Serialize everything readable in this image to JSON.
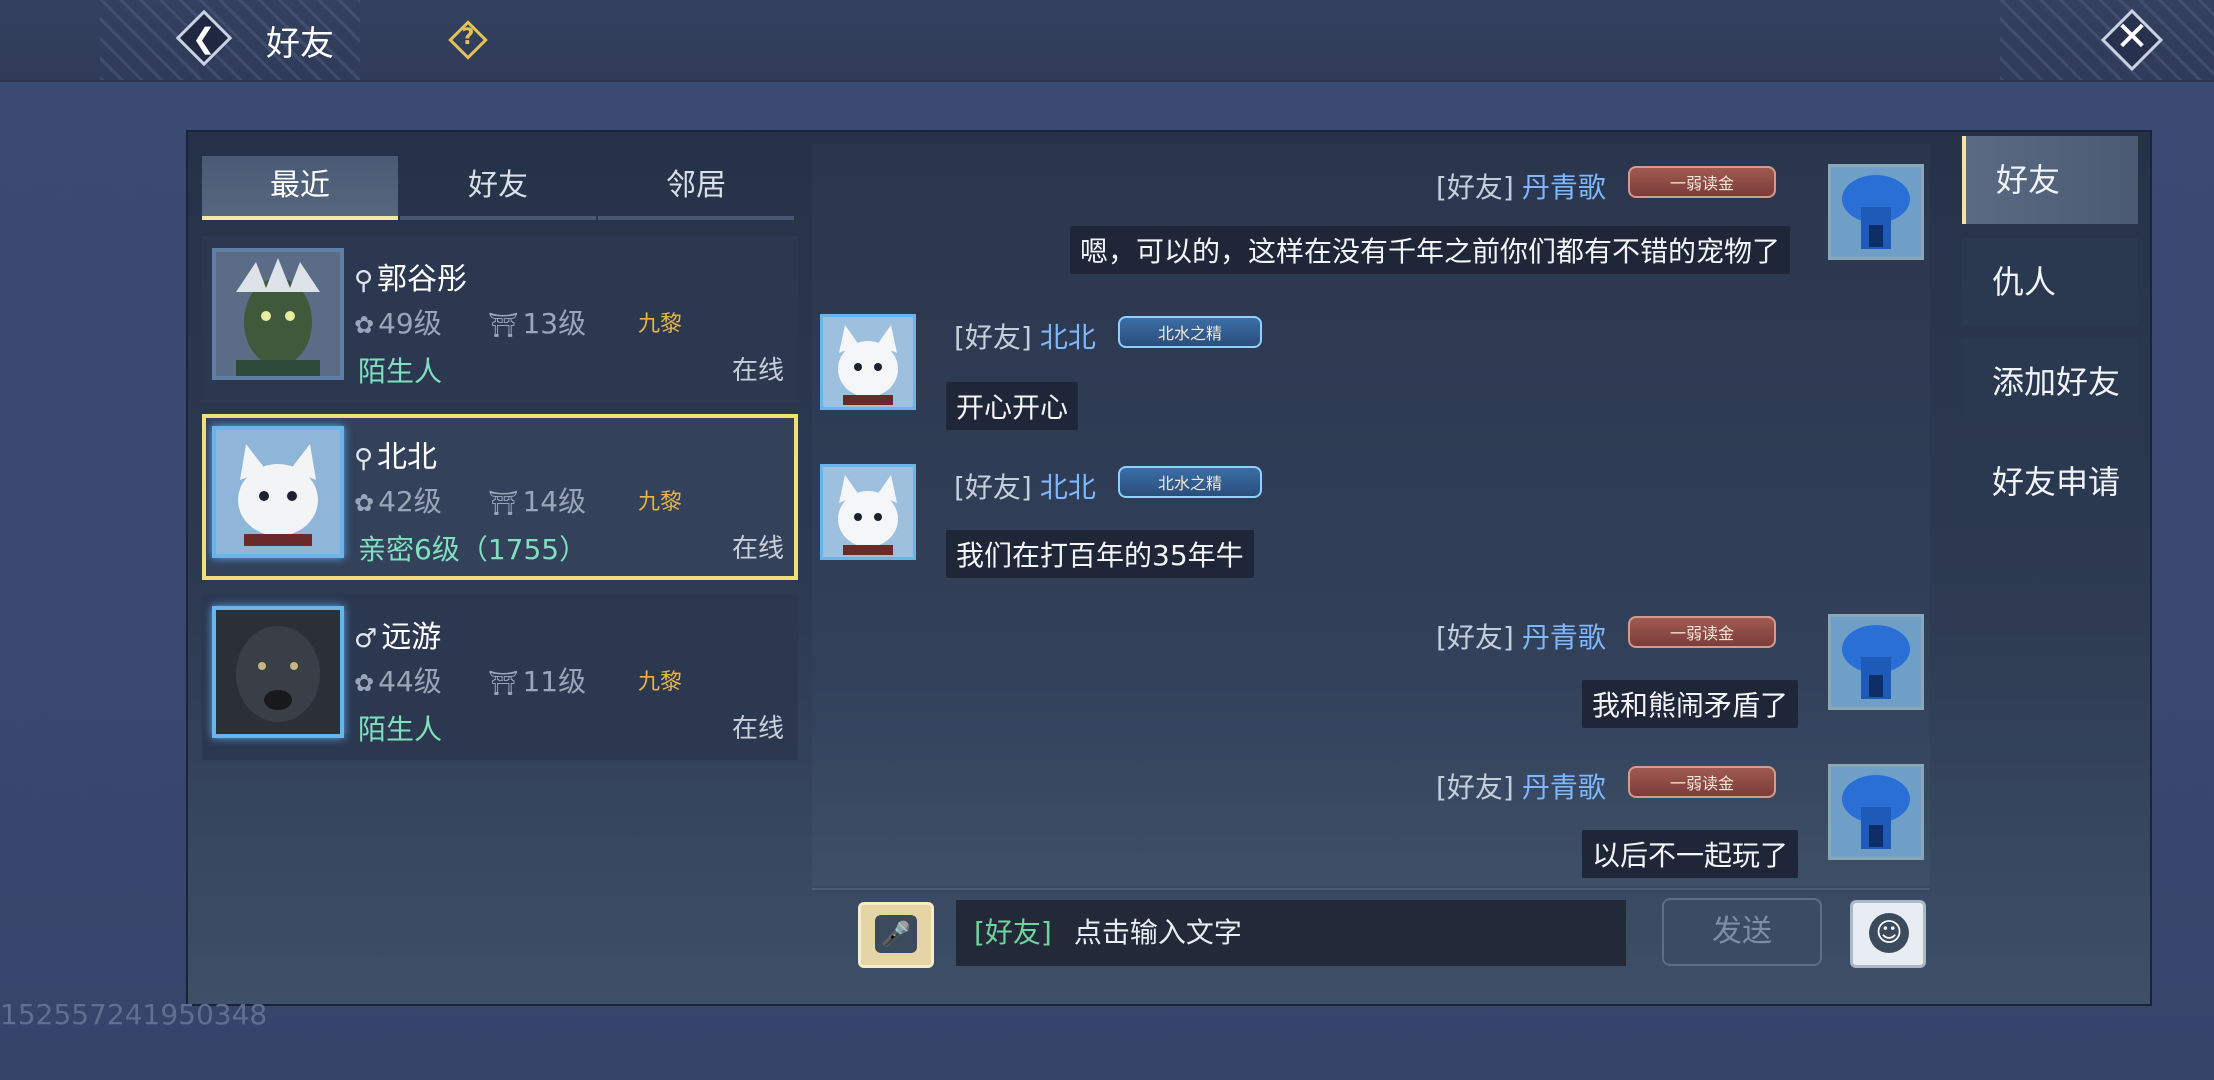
{
  "header": {
    "title": "好友",
    "icons": {
      "back": "back-arrow-icon",
      "help": "help-icon",
      "close": "close-icon"
    }
  },
  "left_tabs": [
    "最近",
    "好友",
    "邻居"
  ],
  "friends": [
    {
      "gender_icon": "⚲",
      "name": "郭谷彤",
      "pet_level": "49级",
      "house_level": "13级",
      "house_tag": "九黎",
      "relation": "陌生人",
      "status": "在线"
    },
    {
      "gender_icon": "⚲",
      "name": "北北",
      "pet_level": "42级",
      "house_level": "14级",
      "house_tag": "九黎",
      "relation": "亲密6级（1755）",
      "status": "在线"
    },
    {
      "gender_icon": "♂",
      "name": "远游",
      "pet_level": "44级",
      "house_level": "11级",
      "house_tag": "九黎",
      "relation": "陌生人",
      "status": "在线"
    }
  ],
  "messages": [
    {
      "side": "right",
      "channel": "[好友]",
      "sender": "丹青歌",
      "badge": "一弱读金",
      "text": "嗯，可以的，这样在没有千年之前你们都有不错的宠物了"
    },
    {
      "side": "left",
      "channel": "[好友]",
      "sender": "北北",
      "badge": "北水之精",
      "text": "开心开心"
    },
    {
      "side": "left",
      "channel": "[好友]",
      "sender": "北北",
      "badge": "北水之精",
      "text": "我们在打百年的35年牛"
    },
    {
      "side": "right",
      "channel": "[好友]",
      "sender": "丹青歌",
      "badge": "一弱读金",
      "text": "我和熊闹矛盾了"
    },
    {
      "side": "right",
      "channel": "[好友]",
      "sender": "丹青歌",
      "badge": "一弱读金",
      "text": "以后不一起玩了"
    }
  ],
  "input": {
    "channel": "[好友]",
    "placeholder": "点击输入文字",
    "send_label": "发送"
  },
  "right_tabs": [
    "好友",
    "仇人",
    "添加好友",
    "好友申请"
  ],
  "uid": "152557241950348",
  "colors": {
    "accent": "#efe07a",
    "name_blue": "#7fb8ff",
    "relation_green": "#7fe0c0",
    "channel_green": "#6fd49b"
  }
}
